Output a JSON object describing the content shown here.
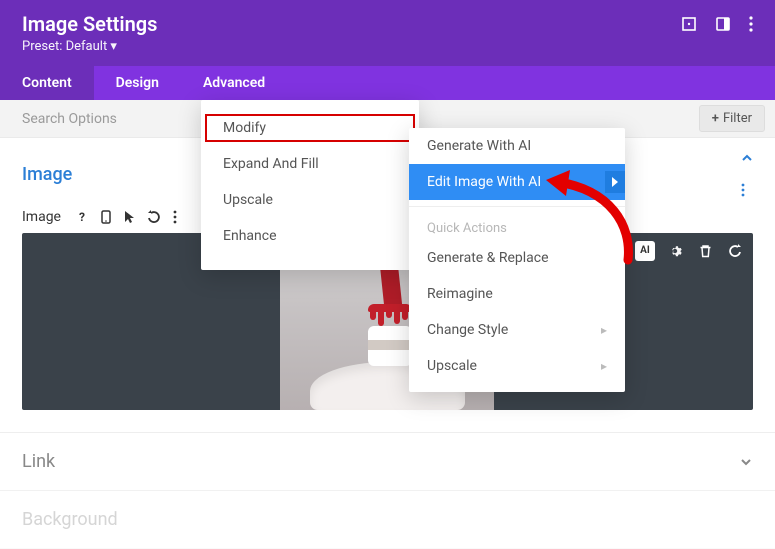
{
  "header": {
    "title": "Image Settings",
    "preset_label": "Preset: Default ▾"
  },
  "tabs": {
    "content": "Content",
    "design": "Design",
    "advanced": "Advanced"
  },
  "search": {
    "placeholder": "Search Options",
    "filter_label": "Filter"
  },
  "section": {
    "image_title": "Image",
    "tool_label": "Image"
  },
  "dropdown1": {
    "modify": "Modify",
    "expand_fill": "Expand And Fill",
    "upscale": "Upscale",
    "enhance": "Enhance"
  },
  "dropdown2": {
    "generate_ai": "Generate With AI",
    "edit_ai": "Edit Image With AI",
    "quick_actions_heading": "Quick Actions",
    "generate_replace": "Generate & Replace",
    "reimagine": "Reimagine",
    "change_style": "Change Style",
    "upscale": "Upscale"
  },
  "canvas_tools": {
    "ai_label": "AI"
  },
  "accordion": {
    "link": "Link",
    "background": "Background"
  }
}
